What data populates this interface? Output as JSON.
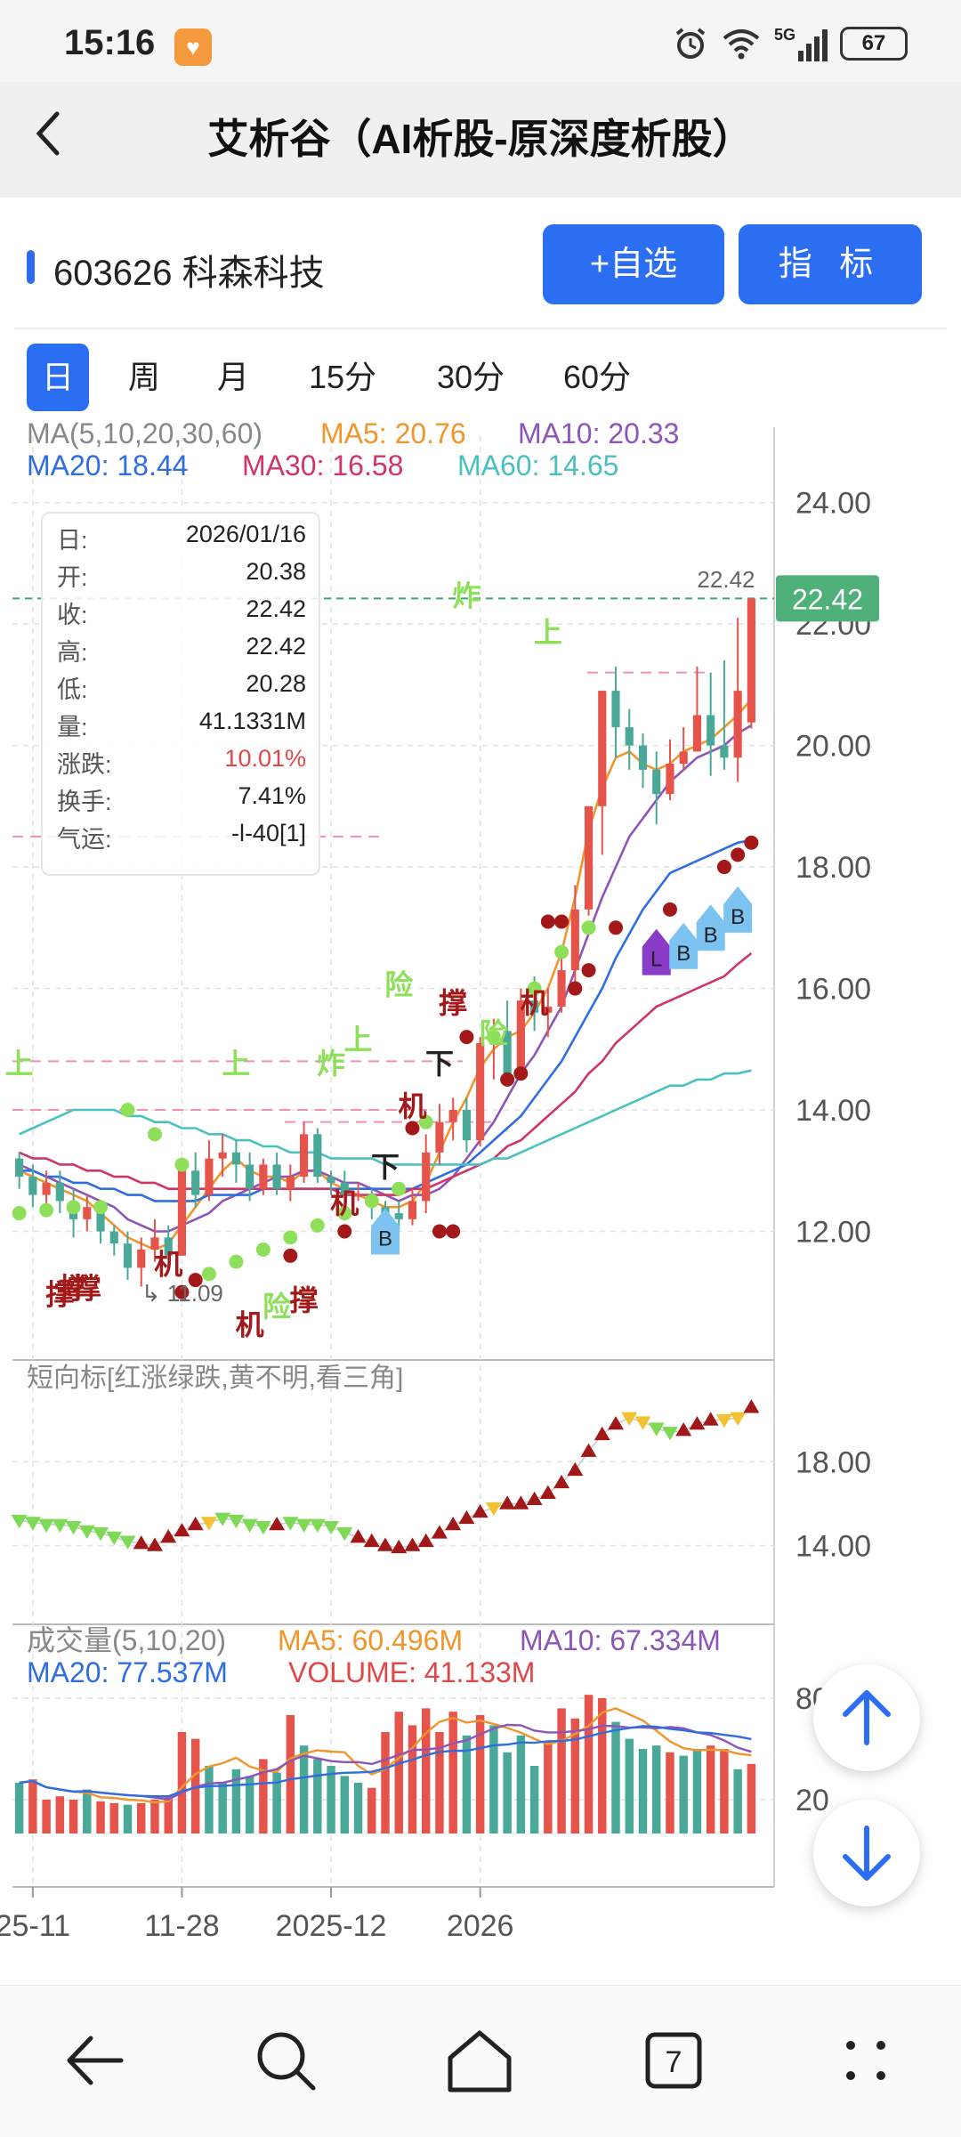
{
  "status_bar": {
    "time": "15:16",
    "app_icon": "heart-app-icon",
    "icons": [
      "alarm-icon",
      "wifi-icon",
      "5g-signal-icon"
    ],
    "network": "5G",
    "battery": "67"
  },
  "header": {
    "back_icon": "chevron-left-icon",
    "title": "艾析谷（AI析股-原深度析股）"
  },
  "stock": {
    "name": "603626 科森科技",
    "add_watch_label": "+自选",
    "indicator_label": "指 标",
    "accent": "#2c6ef2"
  },
  "period_tabs": [
    {
      "label": "日",
      "active": true
    },
    {
      "label": "周",
      "active": false
    },
    {
      "label": "月",
      "active": false
    },
    {
      "label": "15分",
      "active": false
    },
    {
      "label": "30分",
      "active": false
    },
    {
      "label": "60分",
      "active": false
    }
  ],
  "ma_legend": {
    "label": "MA(5,10,20,30,60)",
    "ma5": "MA5: 20.76",
    "ma10": "MA10: 20.33",
    "ma20": "MA20: 18.44",
    "ma30": "MA30: 16.58",
    "ma60": "MA60: 14.65",
    "colors": {
      "ma5": "#f0962c",
      "ma10": "#8e55b8",
      "ma20": "#2f6ee0",
      "ma30": "#cf3566",
      "ma60": "#4bc0c0"
    }
  },
  "info_panel": {
    "rows": [
      {
        "k": "日:",
        "v": "2026/01/16"
      },
      {
        "k": "开:",
        "v": "20.38"
      },
      {
        "k": "收:",
        "v": "22.42"
      },
      {
        "k": "高:",
        "v": "22.42"
      },
      {
        "k": "低:",
        "v": "20.28"
      },
      {
        "k": "量:",
        "v": "41.1331M"
      },
      {
        "k": "涨跌:",
        "v": "10.01%"
      },
      {
        "k": "换手:",
        "v": "7.41%"
      },
      {
        "k": "气运:",
        "v": "-l-40[1]"
      }
    ],
    "up_color": "#e04848"
  },
  "price_badge": "22.42",
  "high_label": "22.42",
  "low_label": "11.09",
  "sub_panel": {
    "title": "短向标[红涨绿跌,黄不明,看三角]",
    "ticks": [
      "18.00",
      "14.00"
    ]
  },
  "volume_panel": {
    "title": "成交量(5,10,20)",
    "ma5": "MA5: 60.496M",
    "ma10": "MA10: 67.334M",
    "ma20": "MA20: 77.537M",
    "volume": "VOLUME: 41.133M",
    "ticks": [
      "80",
      "20"
    ]
  },
  "price_ticks": [
    "24.00",
    "22.00",
    "20.00",
    "18.00",
    "16.00",
    "14.00",
    "12.00"
  ],
  "x_ticks": [
    "25-11",
    "11-28",
    "2025-12",
    "2026"
  ],
  "annotations": {
    "ji": "机",
    "cheng": "撑",
    "xian": "险",
    "xia": "下",
    "zha": "炸",
    "shang": "上",
    "b": "B",
    "l": "L"
  },
  "chart_data": {
    "type": "candlestick",
    "y_axis_ticks": [
      24,
      22,
      20,
      18,
      16,
      14,
      12
    ],
    "ylim": [
      10.0,
      24.8
    ],
    "candles": [
      {
        "o": 13.2,
        "c": 12.9,
        "h": 13.3,
        "l": 12.7
      },
      {
        "o": 12.9,
        "c": 12.6,
        "h": 13.1,
        "l": 12.4
      },
      {
        "o": 12.6,
        "c": 12.8,
        "h": 13.0,
        "l": 12.4
      },
      {
        "o": 12.8,
        "c": 12.5,
        "h": 13.0,
        "l": 12.3
      },
      {
        "o": 12.5,
        "c": 12.2,
        "h": 12.7,
        "l": 11.9
      },
      {
        "o": 12.2,
        "c": 12.4,
        "h": 12.6,
        "l": 12.0
      },
      {
        "o": 12.4,
        "c": 12.0,
        "h": 12.5,
        "l": 11.8
      },
      {
        "o": 12.0,
        "c": 11.8,
        "h": 12.1,
        "l": 11.6
      },
      {
        "o": 11.8,
        "c": 11.4,
        "h": 12.0,
        "l": 11.2
      },
      {
        "o": 11.4,
        "c": 11.7,
        "h": 11.9,
        "l": 11.09
      },
      {
        "o": 11.7,
        "c": 11.9,
        "h": 12.2,
        "l": 11.5
      },
      {
        "o": 11.9,
        "c": 11.6,
        "h": 12.1,
        "l": 11.4
      },
      {
        "o": 11.6,
        "c": 13.0,
        "h": 13.1,
        "l": 11.6
      },
      {
        "o": 13.0,
        "c": 12.6,
        "h": 13.3,
        "l": 12.4
      },
      {
        "o": 12.6,
        "c": 13.2,
        "h": 13.5,
        "l": 12.5
      },
      {
        "o": 13.2,
        "c": 13.3,
        "h": 13.6,
        "l": 12.9
      },
      {
        "o": 13.3,
        "c": 13.1,
        "h": 13.5,
        "l": 12.8
      },
      {
        "o": 13.1,
        "c": 12.7,
        "h": 13.3,
        "l": 12.5
      },
      {
        "o": 12.7,
        "c": 13.1,
        "h": 13.2,
        "l": 12.6
      },
      {
        "o": 13.1,
        "c": 12.7,
        "h": 13.3,
        "l": 12.6
      },
      {
        "o": 12.7,
        "c": 12.9,
        "h": 13.1,
        "l": 12.5
      },
      {
        "o": 12.9,
        "c": 13.6,
        "h": 13.8,
        "l": 12.8
      },
      {
        "o": 13.6,
        "c": 12.9,
        "h": 13.7,
        "l": 12.8
      },
      {
        "o": 12.9,
        "c": 12.8,
        "h": 13.0,
        "l": 12.6
      },
      {
        "o": 12.8,
        "c": 12.6,
        "h": 13.0,
        "l": 12.4
      },
      {
        "o": 12.6,
        "c": 12.6,
        "h": 12.8,
        "l": 12.5
      },
      {
        "o": 12.6,
        "c": 12.4,
        "h": 12.7,
        "l": 12.2
      },
      {
        "o": 12.4,
        "c": 12.3,
        "h": 12.5,
        "l": 12.2
      },
      {
        "o": 12.3,
        "c": 12.2,
        "h": 12.5,
        "l": 12.0
      },
      {
        "o": 12.2,
        "c": 12.5,
        "h": 12.7,
        "l": 12.1
      },
      {
        "o": 12.5,
        "c": 13.3,
        "h": 13.6,
        "l": 12.3
      },
      {
        "o": 13.3,
        "c": 13.8,
        "h": 14.1,
        "l": 13.1
      },
      {
        "o": 13.8,
        "c": 14.0,
        "h": 14.2,
        "l": 13.5
      },
      {
        "o": 14.0,
        "c": 13.5,
        "h": 14.2,
        "l": 13.3
      },
      {
        "o": 13.5,
        "c": 15.1,
        "h": 15.2,
        "l": 13.4
      },
      {
        "o": 15.1,
        "c": 15.3,
        "h": 15.5,
        "l": 14.5
      },
      {
        "o": 15.3,
        "c": 14.6,
        "h": 15.8,
        "l": 14.4
      },
      {
        "o": 14.6,
        "c": 15.8,
        "h": 16.0,
        "l": 14.5
      },
      {
        "o": 15.8,
        "c": 15.6,
        "h": 16.2,
        "l": 15.3
      },
      {
        "o": 15.6,
        "c": 15.7,
        "h": 16.0,
        "l": 15.2
      },
      {
        "o": 15.7,
        "c": 16.3,
        "h": 16.6,
        "l": 15.6
      },
      {
        "o": 16.3,
        "c": 17.3,
        "h": 17.7,
        "l": 16.1
      },
      {
        "o": 17.3,
        "c": 19.0,
        "h": 19.0,
        "l": 17.2
      },
      {
        "o": 19.0,
        "c": 20.9,
        "h": 20.9,
        "l": 18.2
      },
      {
        "o": 20.9,
        "c": 20.3,
        "h": 21.3,
        "l": 19.8
      },
      {
        "o": 20.3,
        "c": 20.0,
        "h": 20.6,
        "l": 19.6
      },
      {
        "o": 20.0,
        "c": 19.6,
        "h": 20.2,
        "l": 19.3
      },
      {
        "o": 19.6,
        "c": 19.2,
        "h": 19.9,
        "l": 18.7
      },
      {
        "o": 19.2,
        "c": 19.7,
        "h": 20.1,
        "l": 19.1
      },
      {
        "o": 19.7,
        "c": 19.9,
        "h": 20.3,
        "l": 19.6
      },
      {
        "o": 19.9,
        "c": 20.5,
        "h": 21.3,
        "l": 19.9
      },
      {
        "o": 20.5,
        "c": 20.0,
        "h": 21.2,
        "l": 19.5
      },
      {
        "o": 20.0,
        "c": 19.8,
        "h": 21.4,
        "l": 19.6
      },
      {
        "o": 19.8,
        "c": 20.9,
        "h": 22.1,
        "l": 19.4
      },
      {
        "o": 20.38,
        "c": 22.42,
        "h": 22.42,
        "l": 20.28
      }
    ],
    "ma_series": [
      {
        "name": "MA5",
        "values": [
          13.0,
          12.9,
          12.8,
          12.7,
          12.6,
          12.5,
          12.3,
          12.1,
          11.9,
          11.8,
          11.7,
          11.8,
          12.1,
          12.4,
          12.7,
          13.0,
          13.2,
          13.0,
          12.9,
          12.9,
          12.8,
          13.0,
          13.0,
          12.8,
          12.7,
          12.6,
          12.5,
          12.4,
          12.4,
          12.5,
          12.8,
          13.3,
          13.8,
          14.2,
          14.7,
          15.0,
          15.2,
          15.3,
          15.6,
          16.0,
          16.6,
          17.5,
          18.6,
          19.3,
          19.8,
          19.9,
          19.7,
          19.6,
          19.7,
          19.9,
          20.0,
          20.1,
          20.3,
          20.5,
          20.76
        ]
      },
      {
        "name": "MA10",
        "values": [
          13.1,
          13.0,
          12.9,
          12.8,
          12.7,
          12.6,
          12.5,
          12.4,
          12.2,
          12.1,
          12.0,
          12.0,
          12.1,
          12.2,
          12.3,
          12.5,
          12.6,
          12.7,
          12.8,
          12.9,
          12.9,
          13.0,
          13.0,
          12.9,
          12.8,
          12.8,
          12.7,
          12.6,
          12.5,
          12.6,
          12.6,
          12.7,
          12.9,
          13.2,
          13.5,
          13.8,
          14.2,
          14.6,
          14.9,
          15.3,
          15.7,
          16.3,
          16.9,
          17.5,
          18.0,
          18.5,
          18.8,
          19.1,
          19.4,
          19.6,
          19.8,
          19.9,
          20.0,
          20.2,
          20.33
        ]
      },
      {
        "name": "MA20",
        "values": [
          13.0,
          13.0,
          12.9,
          12.9,
          12.8,
          12.8,
          12.7,
          12.7,
          12.6,
          12.6,
          12.5,
          12.5,
          12.5,
          12.5,
          12.6,
          12.6,
          12.6,
          12.6,
          12.7,
          12.7,
          12.7,
          12.7,
          12.7,
          12.7,
          12.7,
          12.7,
          12.7,
          12.7,
          12.7,
          12.7,
          12.8,
          12.9,
          13.0,
          13.1,
          13.3,
          13.5,
          13.7,
          13.9,
          14.2,
          14.5,
          14.8,
          15.2,
          15.6,
          16.0,
          16.5,
          16.9,
          17.3,
          17.6,
          17.9,
          18.0,
          18.1,
          18.2,
          18.3,
          18.4,
          18.44
        ]
      },
      {
        "name": "MA30",
        "values": [
          13.3,
          13.2,
          13.2,
          13.1,
          13.1,
          13.0,
          13.0,
          12.9,
          12.9,
          12.8,
          12.8,
          12.7,
          12.7,
          12.7,
          12.7,
          12.7,
          12.7,
          12.7,
          12.7,
          12.7,
          12.7,
          12.7,
          12.7,
          12.7,
          12.6,
          12.6,
          12.6,
          12.6,
          12.6,
          12.7,
          12.7,
          12.8,
          12.9,
          13.0,
          13.1,
          13.2,
          13.4,
          13.5,
          13.7,
          13.9,
          14.1,
          14.3,
          14.6,
          14.8,
          15.1,
          15.3,
          15.5,
          15.7,
          15.8,
          15.9,
          16.0,
          16.1,
          16.2,
          16.4,
          16.58
        ]
      },
      {
        "name": "MA60",
        "values": [
          13.6,
          13.7,
          13.8,
          13.9,
          14.0,
          14.0,
          14.0,
          14.0,
          13.9,
          13.9,
          13.8,
          13.8,
          13.7,
          13.7,
          13.6,
          13.6,
          13.5,
          13.5,
          13.4,
          13.4,
          13.3,
          13.3,
          13.3,
          13.2,
          13.2,
          13.2,
          13.2,
          13.1,
          13.1,
          13.1,
          13.1,
          13.1,
          13.1,
          13.1,
          13.1,
          13.2,
          13.2,
          13.3,
          13.4,
          13.5,
          13.6,
          13.7,
          13.8,
          13.9,
          14.0,
          14.1,
          14.2,
          14.3,
          14.4,
          14.4,
          14.5,
          14.5,
          14.6,
          14.6,
          14.65
        ]
      }
    ],
    "trend_values": [
      15.2,
      15.1,
      15.0,
      15.0,
      14.9,
      14.7,
      14.6,
      14.4,
      14.2,
      14.1,
      14.0,
      14.4,
      14.7,
      15.0,
      15.1,
      15.3,
      15.2,
      15.0,
      14.9,
      15.0,
      15.1,
      15.0,
      15.0,
      14.9,
      14.6,
      14.4,
      14.2,
      14.0,
      13.9,
      14.0,
      14.2,
      14.6,
      15.0,
      15.3,
      15.6,
      15.8,
      16.0,
      16.0,
      16.2,
      16.5,
      17.0,
      17.6,
      18.5,
      19.3,
      19.8,
      20.1,
      19.9,
      19.6,
      19.4,
      19.5,
      19.8,
      20.0,
      20.0,
      20.1,
      20.6
    ],
    "trend_dir": [
      "g",
      "g",
      "g",
      "g",
      "g",
      "g",
      "g",
      "g",
      "g",
      "r",
      "r",
      "r",
      "r",
      "r",
      "y",
      "g",
      "g",
      "g",
      "g",
      "r",
      "g",
      "g",
      "g",
      "g",
      "g",
      "r",
      "r",
      "r",
      "r",
      "r",
      "r",
      "r",
      "r",
      "r",
      "r",
      "y",
      "r",
      "r",
      "r",
      "r",
      "r",
      "r",
      "r",
      "r",
      "r",
      "y",
      "y",
      "g",
      "g",
      "r",
      "r",
      "r",
      "y",
      "y",
      "r"
    ],
    "volume_values": [
      30,
      32,
      20,
      22,
      20,
      26,
      19,
      18,
      17,
      18,
      20,
      22,
      60,
      56,
      40,
      30,
      38,
      34,
      44,
      36,
      70,
      52,
      44,
      40,
      34,
      30,
      27,
      60,
      72,
      64,
      74,
      60,
      72,
      58,
      70,
      64,
      48,
      58,
      40,
      54,
      74,
      68,
      82,
      80,
      66,
      56,
      50,
      52,
      48,
      46,
      50,
      52,
      50,
      38,
      41.133
    ],
    "volume_colors": [
      "g",
      "r",
      "r",
      "r",
      "r",
      "g",
      "r",
      "r",
      "g",
      "r",
      "r",
      "r",
      "r",
      "r",
      "g",
      "g",
      "g",
      "g",
      "r",
      "g",
      "r",
      "g",
      "g",
      "g",
      "g",
      "g",
      "r",
      "r",
      "r",
      "r",
      "r",
      "r",
      "r",
      "g",
      "r",
      "g",
      "g",
      "g",
      "g",
      "r",
      "r",
      "r",
      "r",
      "r",
      "g",
      "g",
      "g",
      "g",
      "r",
      "g",
      "g",
      "r",
      "r",
      "g",
      "r"
    ],
    "volume_ylim": [
      0,
      100
    ]
  }
}
